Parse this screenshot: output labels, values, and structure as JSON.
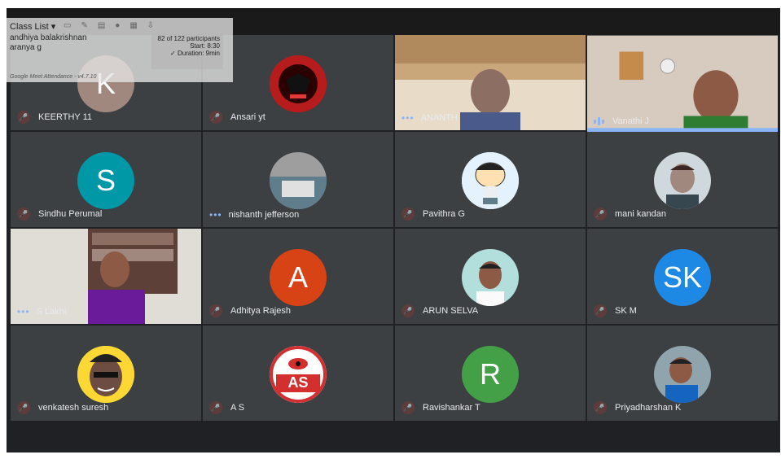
{
  "participants": [
    {
      "name": "KEERTHY 11",
      "initial": "K",
      "color": "#a1887f",
      "mic": "muted"
    },
    {
      "name": "Ansari yt",
      "initial": "",
      "color": "#8b0000",
      "mic": "muted"
    },
    {
      "name": "ANANTH",
      "video": true,
      "mic": "dots"
    },
    {
      "name": "Vanathi J",
      "video": true,
      "mic": "speaking"
    },
    {
      "name": "Sindhu Perumal",
      "initial": "S",
      "color": "#0097a7",
      "mic": "muted"
    },
    {
      "name": "nishanth jefferson",
      "initial": "",
      "color": "#9e9e9e",
      "mic": "dots"
    },
    {
      "name": "Pavithra G",
      "initial": "",
      "color": "#e3f2fd",
      "mic": "muted"
    },
    {
      "name": "mani kandan",
      "initial": "",
      "color": "#cfd8dc",
      "mic": "muted"
    },
    {
      "name": "S Lakhi",
      "video": true,
      "mic": "dots"
    },
    {
      "name": "Adhitya Rajesh",
      "initial": "A",
      "color": "#d84315",
      "mic": "muted"
    },
    {
      "name": "ARUN SELVA",
      "initial": "",
      "color": "#b2dfdb",
      "mic": "muted"
    },
    {
      "name": "SK M",
      "initial": "SK",
      "color": "#1e88e5",
      "mic": "muted"
    },
    {
      "name": "venkatesh suresh",
      "initial": "",
      "color": "#fdd835",
      "mic": "muted"
    },
    {
      "name": "A S",
      "initial": "AS",
      "color": "#ffffff",
      "mic": "muted"
    },
    {
      "name": "Ravishankar T",
      "initial": "R",
      "color": "#43a047",
      "mic": "muted"
    },
    {
      "name": "Priyadharshan K",
      "initial": "",
      "color": "#90a4ae",
      "mic": "muted"
    }
  ],
  "extension": {
    "dropdown": "Class List",
    "names": [
      "andhiya balakrishnan",
      "aranya g"
    ],
    "count": "82 of 122 participants",
    "start": "Start: 8:30",
    "duration": "✓ Duration: 9min",
    "footer": "Google Meet Attendance - v4.7.10"
  },
  "colors": {
    "tile": "#3c4043",
    "bg": "#202124",
    "speaking": "#8ab4f8",
    "muted": "#5f3c3c"
  }
}
